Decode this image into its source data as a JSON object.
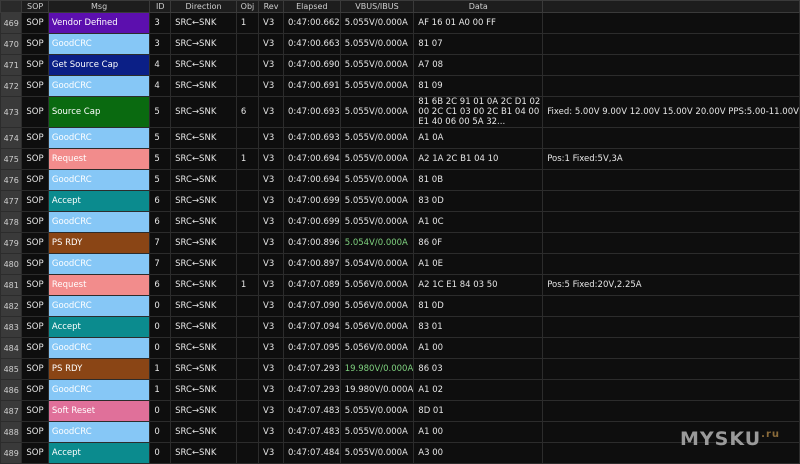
{
  "header": {
    "idx": "",
    "sop": "SOP",
    "msg": "Msg",
    "id": "ID",
    "direction": "Direction",
    "obj": "Obj",
    "rev": "Rev",
    "elapsed": "Elapsed",
    "vbus": "VBUS/IBUS",
    "data": "Data",
    "extra": ""
  },
  "message_colors": {
    "Vendor Defined": "#5c0fae",
    "GoodCRC": "#86c7f6",
    "Get Source Cap": "#0b1f86",
    "Source Cap": "#0a6a10",
    "Request": "#f28c8c",
    "Accept": "#0b8b8e",
    "PS RDY": "#8a4515",
    "Soft Reset": "#e0709a"
  },
  "rows": [
    {
      "idx": "469",
      "sop": "SOP",
      "msg": "Vendor Defined",
      "id": "3",
      "direction": "SRC←SNK",
      "obj": "1",
      "rev": "V3",
      "elapsed": "0:47:00.662",
      "vbus": "5.055V/0.000A",
      "data": "AF 16 01 A0 00 FF",
      "extra": ""
    },
    {
      "idx": "470",
      "sop": "SOP",
      "msg": "GoodCRC",
      "id": "3",
      "direction": "SRC→SNK",
      "obj": "",
      "rev": "V3",
      "elapsed": "0:47:00.663",
      "vbus": "5.055V/0.000A",
      "data": "81 07",
      "extra": ""
    },
    {
      "idx": "471",
      "sop": "SOP",
      "msg": "Get Source Cap",
      "id": "4",
      "direction": "SRC←SNK",
      "obj": "",
      "rev": "V3",
      "elapsed": "0:47:00.690",
      "vbus": "5.055V/0.000A",
      "data": "A7 08",
      "extra": ""
    },
    {
      "idx": "472",
      "sop": "SOP",
      "msg": "GoodCRC",
      "id": "4",
      "direction": "SRC→SNK",
      "obj": "",
      "rev": "V3",
      "elapsed": "0:47:00.691",
      "vbus": "5.055V/0.000A",
      "data": "81 09",
      "extra": ""
    },
    {
      "idx": "473",
      "sop": "SOP",
      "msg": "Source Cap",
      "id": "5",
      "direction": "SRC→SNK",
      "obj": "6",
      "rev": "V3",
      "elapsed": "0:47:00.693",
      "vbus": "5.055V/0.000A",
      "data": "81 6B 2C 91 01 0A 2C D1 02 00 2C C1 03 00 2C B1 04 00 E1 40 06 00 5A 32...",
      "extra": "Fixed: 5.00V  9.00V  12.00V  15.00V  20.00V  PPS:5.00-11.00V"
    },
    {
      "idx": "474",
      "sop": "SOP",
      "msg": "GoodCRC",
      "id": "5",
      "direction": "SRC←SNK",
      "obj": "",
      "rev": "V3",
      "elapsed": "0:47:00.693",
      "vbus": "5.055V/0.000A",
      "data": "A1 0A",
      "extra": ""
    },
    {
      "idx": "475",
      "sop": "SOP",
      "msg": "Request",
      "id": "5",
      "direction": "SRC←SNK",
      "obj": "1",
      "rev": "V3",
      "elapsed": "0:47:00.694",
      "vbus": "5.055V/0.000A",
      "data": "A2 1A 2C B1 04 10",
      "extra": "Pos:1 Fixed:5V,3A"
    },
    {
      "idx": "476",
      "sop": "SOP",
      "msg": "GoodCRC",
      "id": "5",
      "direction": "SRC→SNK",
      "obj": "",
      "rev": "V3",
      "elapsed": "0:47:00.694",
      "vbus": "5.055V/0.000A",
      "data": "81 0B",
      "extra": ""
    },
    {
      "idx": "477",
      "sop": "SOP",
      "msg": "Accept",
      "id": "6",
      "direction": "SRC→SNK",
      "obj": "",
      "rev": "V3",
      "elapsed": "0:47:00.699",
      "vbus": "5.055V/0.000A",
      "data": "83 0D",
      "extra": ""
    },
    {
      "idx": "478",
      "sop": "SOP",
      "msg": "GoodCRC",
      "id": "6",
      "direction": "SRC←SNK",
      "obj": "",
      "rev": "V3",
      "elapsed": "0:47:00.699",
      "vbus": "5.055V/0.000A",
      "data": "A1 0C",
      "extra": ""
    },
    {
      "idx": "479",
      "sop": "SOP",
      "msg": "PS RDY",
      "id": "7",
      "direction": "SRC→SNK",
      "obj": "",
      "rev": "V3",
      "elapsed": "0:47:00.896",
      "vbus": "5.054V/0.000A",
      "data": "86 0F",
      "extra": "",
      "green": true
    },
    {
      "idx": "480",
      "sop": "SOP",
      "msg": "GoodCRC",
      "id": "7",
      "direction": "SRC←SNK",
      "obj": "",
      "rev": "V3",
      "elapsed": "0:47:00.897",
      "vbus": "5.054V/0.000A",
      "data": "A1 0E",
      "extra": ""
    },
    {
      "idx": "481",
      "sop": "SOP",
      "msg": "Request",
      "id": "6",
      "direction": "SRC←SNK",
      "obj": "1",
      "rev": "V3",
      "elapsed": "0:47:07.089",
      "vbus": "5.056V/0.000A",
      "data": "A2 1C E1 84 03 50",
      "extra": "Pos:5 Fixed:20V,2.25A"
    },
    {
      "idx": "482",
      "sop": "SOP",
      "msg": "GoodCRC",
      "id": "0",
      "direction": "SRC→SNK",
      "obj": "",
      "rev": "V3",
      "elapsed": "0:47:07.090",
      "vbus": "5.056V/0.000A",
      "data": "81 0D",
      "extra": ""
    },
    {
      "idx": "483",
      "sop": "SOP",
      "msg": "Accept",
      "id": "0",
      "direction": "SRC→SNK",
      "obj": "",
      "rev": "V3",
      "elapsed": "0:47:07.094",
      "vbus": "5.056V/0.000A",
      "data": "83 01",
      "extra": ""
    },
    {
      "idx": "484",
      "sop": "SOP",
      "msg": "GoodCRC",
      "id": "0",
      "direction": "SRC←SNK",
      "obj": "",
      "rev": "V3",
      "elapsed": "0:47:07.095",
      "vbus": "5.056V/0.000A",
      "data": "A1 00",
      "extra": ""
    },
    {
      "idx": "485",
      "sop": "SOP",
      "msg": "PS RDY",
      "id": "1",
      "direction": "SRC→SNK",
      "obj": "",
      "rev": "V3",
      "elapsed": "0:47:07.293",
      "vbus": "19.980V/0.000A",
      "data": "86 03",
      "extra": "",
      "green": true
    },
    {
      "idx": "486",
      "sop": "SOP",
      "msg": "GoodCRC",
      "id": "1",
      "direction": "SRC←SNK",
      "obj": "",
      "rev": "V3",
      "elapsed": "0:47:07.293",
      "vbus": "19.980V/0.000A",
      "data": "A1 02",
      "extra": ""
    },
    {
      "idx": "487",
      "sop": "SOP",
      "msg": "Soft Reset",
      "id": "0",
      "direction": "SRC→SNK",
      "obj": "",
      "rev": "V3",
      "elapsed": "0:47:07.483",
      "vbus": "5.055V/0.000A",
      "data": "8D 01",
      "extra": ""
    },
    {
      "idx": "488",
      "sop": "SOP",
      "msg": "GoodCRC",
      "id": "0",
      "direction": "SRC←SNK",
      "obj": "",
      "rev": "V3",
      "elapsed": "0:47:07.483",
      "vbus": "5.055V/0.000A",
      "data": "A1 00",
      "extra": ""
    },
    {
      "idx": "489",
      "sop": "SOP",
      "msg": "Accept",
      "id": "0",
      "direction": "SRC←SNK",
      "obj": "",
      "rev": "V3",
      "elapsed": "0:47:07.484",
      "vbus": "5.055V/0.000A",
      "data": "A3 00",
      "extra": ""
    }
  ],
  "watermark": {
    "text": "MYSKU",
    "suffix": ".ru"
  }
}
